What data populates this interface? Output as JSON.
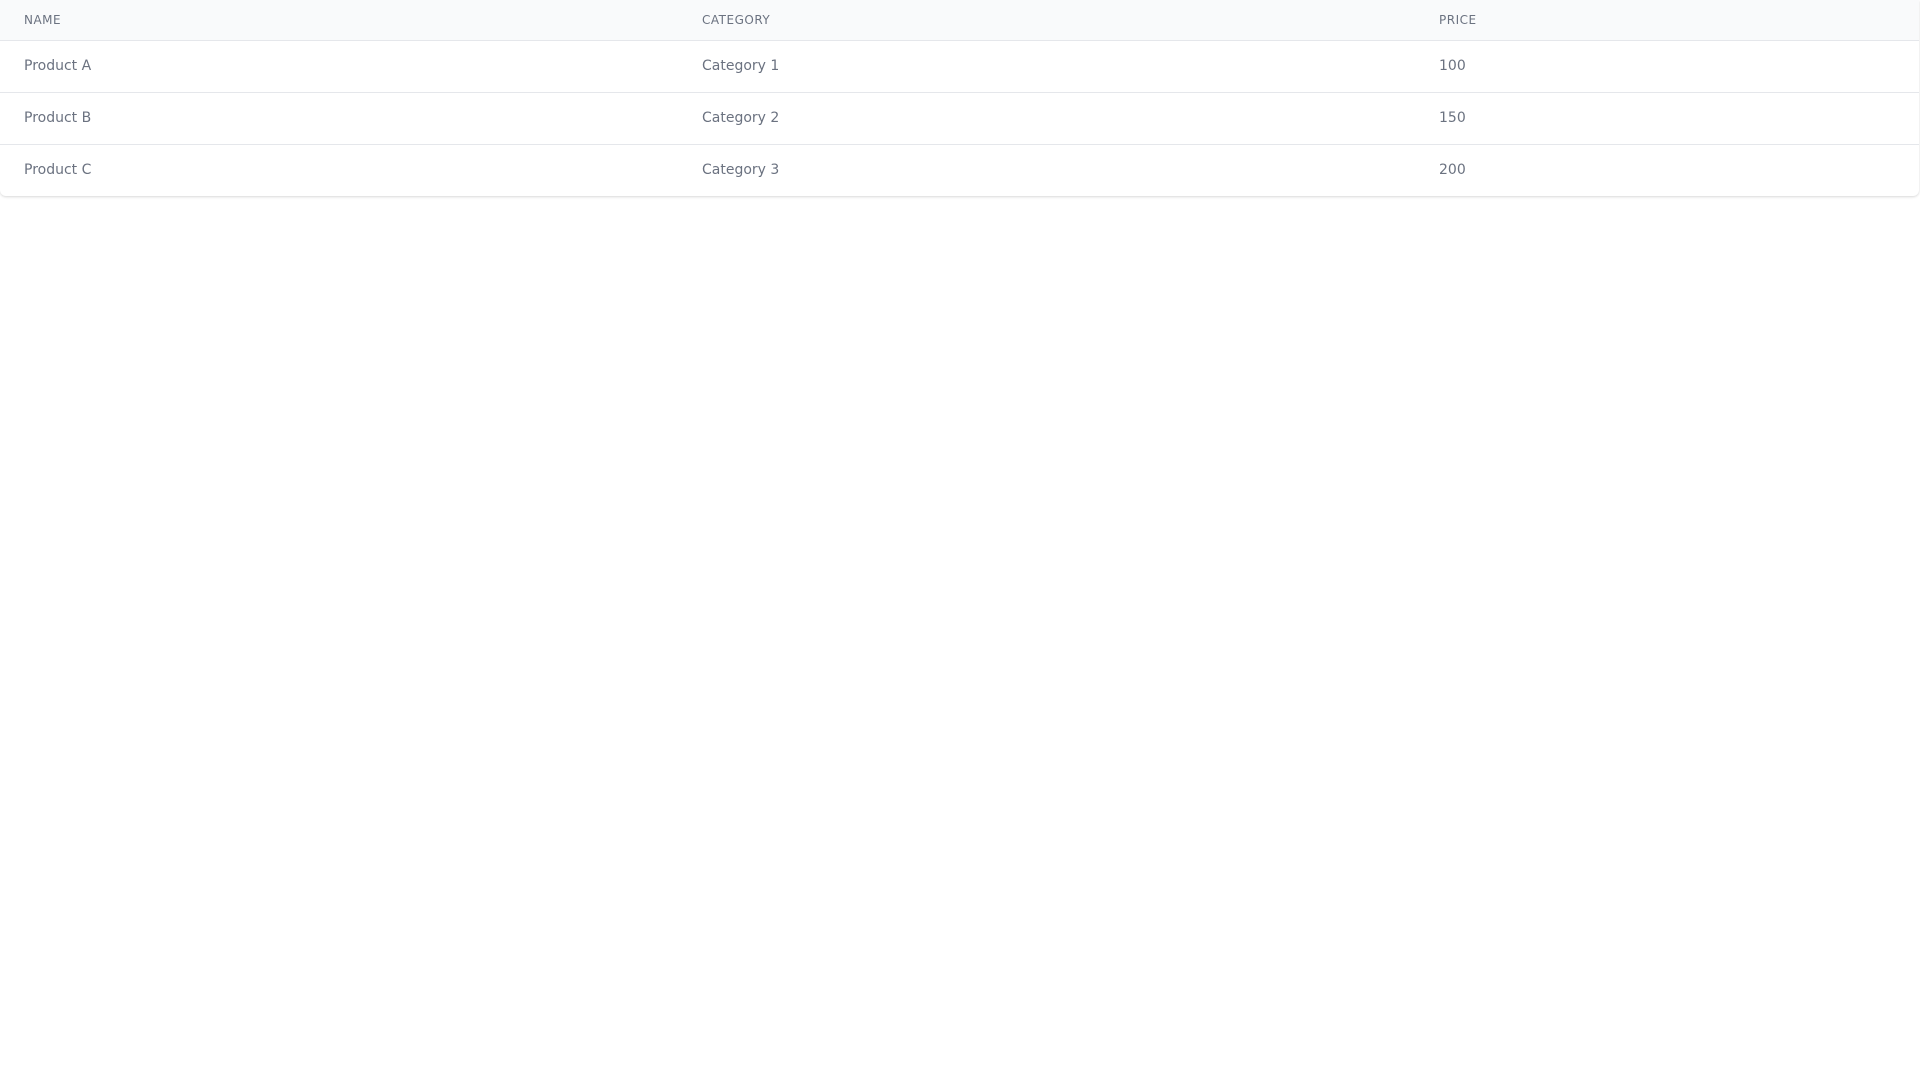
{
  "table": {
    "columns": [
      "NAME",
      "CATEGORY",
      "PRICE"
    ],
    "rows": [
      {
        "name": "Product A",
        "category": "Category 1",
        "price": "100"
      },
      {
        "name": "Product B",
        "category": "Category 2",
        "price": "150"
      },
      {
        "name": "Product C",
        "category": "Category 3",
        "price": "200"
      }
    ]
  },
  "colors": {
    "header_bg": "#f9fafb",
    "border": "#e5e7eb",
    "text": "#6b7280"
  }
}
